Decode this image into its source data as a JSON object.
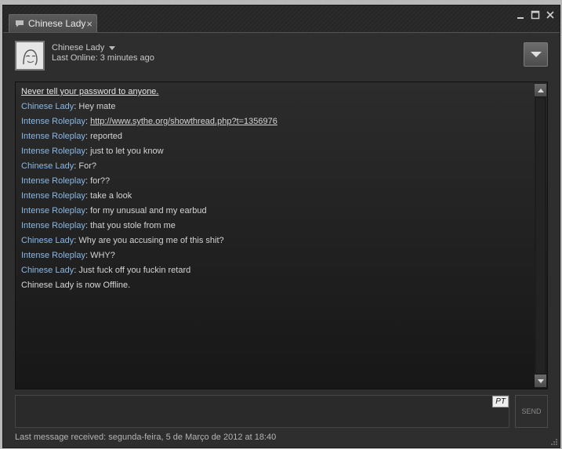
{
  "tab": {
    "title": "Chinese Lady",
    "close": "×"
  },
  "header": {
    "friend_name": "Chinese Lady",
    "last_online": "Last Online: 3 minutes ago"
  },
  "chat": {
    "warning": "Never tell your password to anyone.",
    "messages": [
      {
        "who": "Chinese Lady",
        "text": ": Hey mate"
      },
      {
        "who": "Intense Roleplay",
        "sep": ": ",
        "link": "http://www.sythe.org/showthread.php?t=1356976"
      },
      {
        "who": "Intense Roleplay",
        "text": ": reported"
      },
      {
        "who": "Intense Roleplay",
        "text": ": just to let you know"
      },
      {
        "who": "Chinese Lady",
        "text": ": For?"
      },
      {
        "who": "Intense Roleplay",
        "text": ": for??"
      },
      {
        "who": "Intense Roleplay",
        "text": ": take a look"
      },
      {
        "who": "Intense Roleplay",
        "text": ": for my unusual and my earbud"
      },
      {
        "who": "Intense Roleplay",
        "text": ": that you stole from me"
      },
      {
        "who": "Chinese Lady",
        "text": ": Why are you accusing me of this shit?"
      },
      {
        "who": "Intense Roleplay",
        "text": ": WHY?"
      },
      {
        "who": "Chinese Lady",
        "text": ": Just fuck off you fuckin retard"
      }
    ],
    "offline_notice": "Chinese Lady is now Offline."
  },
  "input": {
    "lang_badge": "PT",
    "send_label": "SEND"
  },
  "status": "Last message received: segunda-feira, 5 de Março de 2012 at 18:40",
  "colors": {
    "friend_name": "#8ab8e6",
    "background": "#2e2e2e"
  },
  "icons": {
    "tab": "chat-bubble-icon",
    "window": [
      "minimize-icon",
      "maximize-icon",
      "close-icon"
    ]
  }
}
